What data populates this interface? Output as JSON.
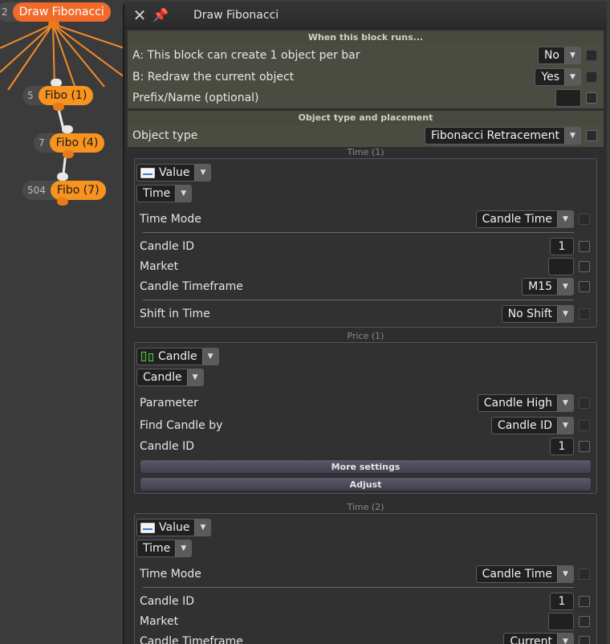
{
  "nodes": [
    {
      "id": "2",
      "label": "Draw Fibonacci"
    },
    {
      "id": "5",
      "label": "Fibo (1)"
    },
    {
      "id": "7",
      "label": "Fibo (4)"
    },
    {
      "id": "504",
      "label": "Fibo (7)"
    }
  ],
  "panel": {
    "title": "Draw Fibonacci",
    "close_icon": "close-icon",
    "pin_icon": "pin-icon",
    "when_header": "When this block runs...",
    "row_a": {
      "label": "A: This block can create 1 object per bar",
      "value": "No"
    },
    "row_b": {
      "label": "B: Redraw the current object",
      "value": "Yes"
    },
    "prefix": {
      "label": "Prefix/Name (optional)",
      "value": ""
    },
    "placement_header": "Object type and placement",
    "object_type": {
      "label": "Object type",
      "value": "Fibonacci Retracement"
    },
    "time1": {
      "caption": "Time (1)",
      "source": "Value",
      "kind": "Time",
      "time_mode": {
        "label": "Time Mode",
        "value": "Candle Time"
      },
      "candle_id": {
        "label": "Candle ID",
        "value": "1"
      },
      "market": {
        "label": "Market",
        "value": ""
      },
      "timeframe": {
        "label": "Candle Timeframe",
        "value": "M15"
      },
      "shift": {
        "label": "Shift in Time",
        "value": "No Shift"
      }
    },
    "price1": {
      "caption": "Price (1)",
      "source": "Candle",
      "kind": "Candle",
      "parameter": {
        "label": "Parameter",
        "value": "Candle High"
      },
      "find_by": {
        "label": "Find Candle by",
        "value": "Candle ID"
      },
      "candle_id": {
        "label": "Candle ID",
        "value": "1"
      },
      "more_settings": "More settings",
      "adjust": "Adjust"
    },
    "time2": {
      "caption": "Time (2)",
      "source": "Value",
      "kind": "Time",
      "time_mode": {
        "label": "Time Mode",
        "value": "Candle Time"
      },
      "candle_id": {
        "label": "Candle ID",
        "value": "1"
      },
      "market": {
        "label": "Market",
        "value": ""
      },
      "timeframe": {
        "label": "Candle Timeframe",
        "value": "Current"
      }
    }
  },
  "colors": {
    "node_main": "#f26a2a",
    "node": "#f7931e",
    "link": "#f7931e"
  }
}
